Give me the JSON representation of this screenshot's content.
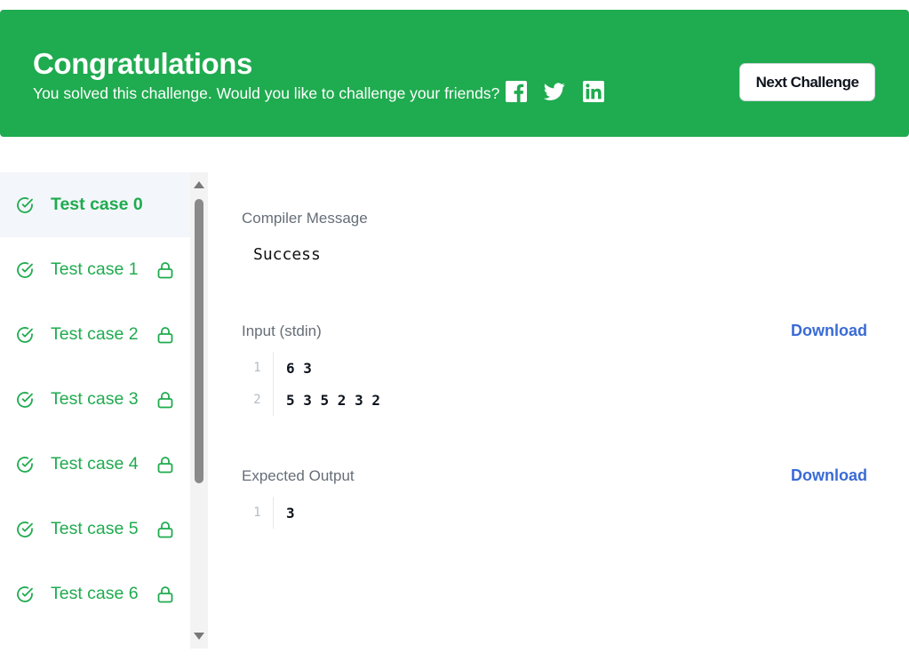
{
  "banner": {
    "title": "Congratulations",
    "subtitle": "You solved this challenge. Would you like to challenge your friends?",
    "share_icons": [
      "facebook-icon",
      "twitter-icon",
      "linkedin-icon"
    ],
    "next_label": "Next Challenge",
    "background": "#1fab4f"
  },
  "test_cases": [
    {
      "label": "Test case 0",
      "status": "passed",
      "locked": false,
      "active": true
    },
    {
      "label": "Test case 1",
      "status": "passed",
      "locked": true,
      "active": false
    },
    {
      "label": "Test case 2",
      "status": "passed",
      "locked": true,
      "active": false
    },
    {
      "label": "Test case 3",
      "status": "passed",
      "locked": true,
      "active": false
    },
    {
      "label": "Test case 4",
      "status": "passed",
      "locked": true,
      "active": false
    },
    {
      "label": "Test case 5",
      "status": "passed",
      "locked": true,
      "active": false
    },
    {
      "label": "Test case 6",
      "status": "passed",
      "locked": true,
      "active": false
    }
  ],
  "compiler": {
    "label": "Compiler Message",
    "message": "Success"
  },
  "input": {
    "label": "Input (stdin)",
    "download_label": "Download",
    "lines": [
      {
        "num": "1",
        "text": "6 3"
      },
      {
        "num": "2",
        "text": "5 3 5 2 3 2"
      }
    ]
  },
  "expected": {
    "label": "Expected Output",
    "download_label": "Download",
    "lines": [
      {
        "num": "1",
        "text": "3"
      }
    ]
  },
  "colors": {
    "success": "#1fab4f",
    "link": "#3a6bd6"
  }
}
